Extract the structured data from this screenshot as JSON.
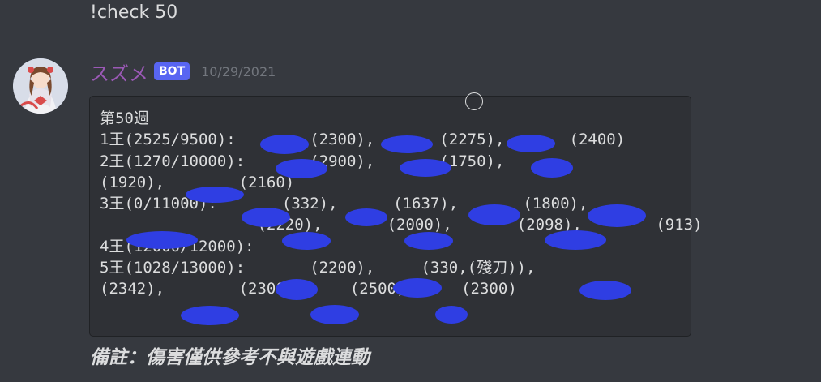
{
  "previous_message": {
    "text": "!check 50"
  },
  "message": {
    "author": "スズメ",
    "badge": "BOT",
    "timestamp": "10/29/2021",
    "code_lines": [
      "第50週",
      "1王(2525/9500):        (2300),       (2275),       (2400)",
      "2王(1270/10000):       (2900),       (1750),",
      "(1920),        (2160)",
      "3王(0/11000):       (332),      (1637),       (1800),",
      "                 (2220),       (2000),       (2098),        (913)",
      "4王(12000/12000):",
      "5王(1028/13000):       (2200),     (330,(殘刀)),",
      "(2342),        (2300)      (2500),     (2300)"
    ],
    "footnote": "備註：傷害僅供參考不與遊戲連動"
  },
  "colors": {
    "background": "#36393f",
    "username": "#9b59b6",
    "badge": "#5865f2",
    "timestamp": "#72767d",
    "codeblock_bg": "#2f3136",
    "redaction": "#2f3ee3"
  },
  "icons": {
    "avatar": "avatar-girl-illustration"
  }
}
